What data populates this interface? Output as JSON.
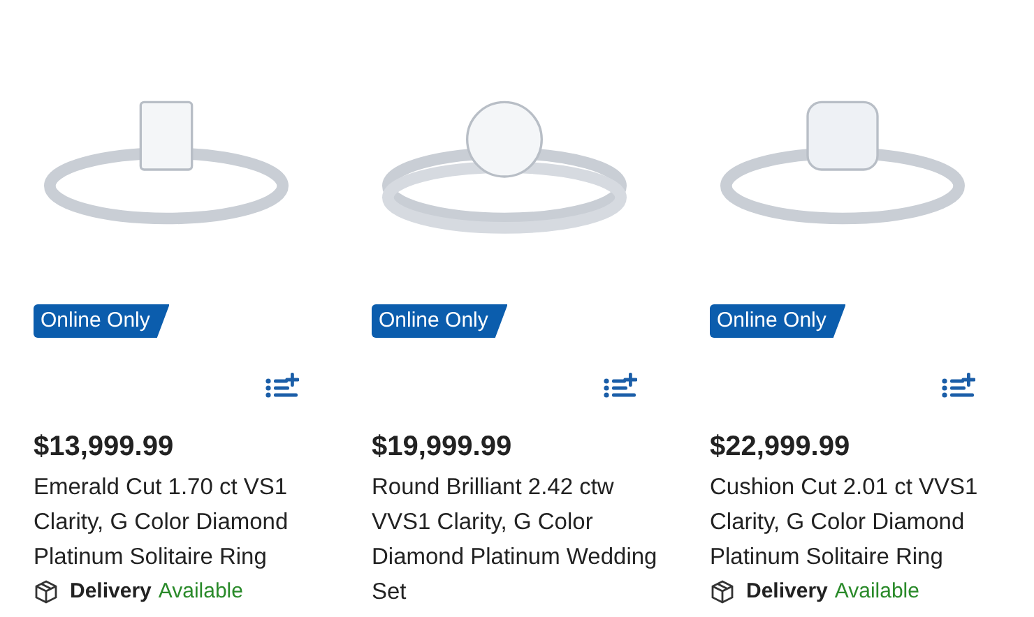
{
  "products": [
    {
      "kind": "emerald",
      "badge": "Online Only",
      "price": "$13,999.99",
      "title": "Emerald Cut 1.70 ct VS1 Clarity, G Color Diamond Platinum Solitaire Ring",
      "delivery": {
        "label": "Delivery",
        "status": "Available"
      }
    },
    {
      "kind": "round",
      "badge": "Online Only",
      "price": "$19,999.99",
      "title": "Round Brilliant 2.42 ctw VVS1 Clarity, G Color Diamond Platinum Wedding Set"
    },
    {
      "kind": "cushion",
      "badge": "Online Only",
      "price": "$22,999.99",
      "title": "Cushion Cut 2.01 ct VVS1 Clarity, G Color Diamond Platinum Solitaire Ring",
      "delivery": {
        "label": "Delivery",
        "status": "Available"
      }
    }
  ]
}
